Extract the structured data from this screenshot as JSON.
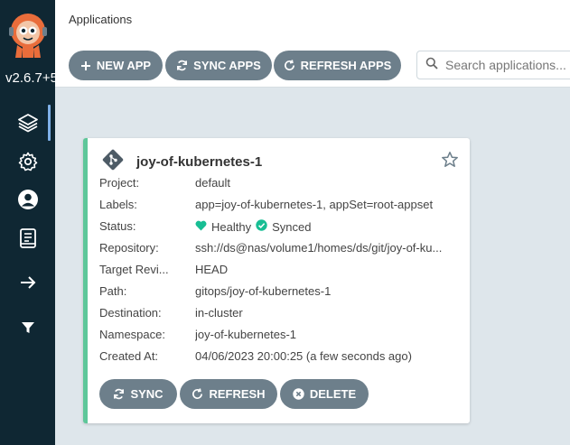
{
  "sidebar": {
    "version": "v2.6.7+5",
    "items": [
      {
        "name": "applications",
        "icon": "layers-icon"
      },
      {
        "name": "settings",
        "icon": "gear-icon"
      },
      {
        "name": "user-info",
        "icon": "user-icon"
      },
      {
        "name": "documentation",
        "icon": "book-icon"
      },
      {
        "name": "expand",
        "icon": "arrow-right-icon"
      },
      {
        "name": "filter",
        "icon": "filter-icon"
      }
    ]
  },
  "header": {
    "title": "Applications"
  },
  "toolbar": {
    "new_app": "NEW APP",
    "sync_apps": "SYNC APPS",
    "refresh_apps": "REFRESH APPS",
    "search_placeholder": "Search applications..."
  },
  "app": {
    "name": "joy-of-kubernetes-1",
    "rows": {
      "project": {
        "label": "Project:",
        "value": "default"
      },
      "labels": {
        "label": "Labels:",
        "value": "app=joy-of-kubernetes-1, appSet=root-appset"
      },
      "status": {
        "label": "Status:",
        "health": "Healthy",
        "sync": "Synced"
      },
      "repository": {
        "label": "Repository:",
        "value": "ssh://ds@nas/volume1/homes/ds/git/joy-of-ku..."
      },
      "target_revision": {
        "label": "Target Revi...",
        "value": "HEAD"
      },
      "path": {
        "label": "Path:",
        "value": "gitops/joy-of-kubernetes-1"
      },
      "destination": {
        "label": "Destination:",
        "value": "in-cluster"
      },
      "namespace": {
        "label": "Namespace:",
        "value": "joy-of-kubernetes-1"
      },
      "created_at": {
        "label": "Created At:",
        "value": "04/06/2023 20:00:25  (a few seconds ago)"
      }
    },
    "actions": {
      "sync": "SYNC",
      "refresh": "REFRESH",
      "delete": "DELETE"
    }
  },
  "colors": {
    "sidebar_bg": "#0f2733",
    "button_bg": "#6d7f8b",
    "healthy": "#18be94",
    "synced": "#18be94",
    "card_accent": "#5ec79a",
    "page_bg": "#dee6eb"
  }
}
